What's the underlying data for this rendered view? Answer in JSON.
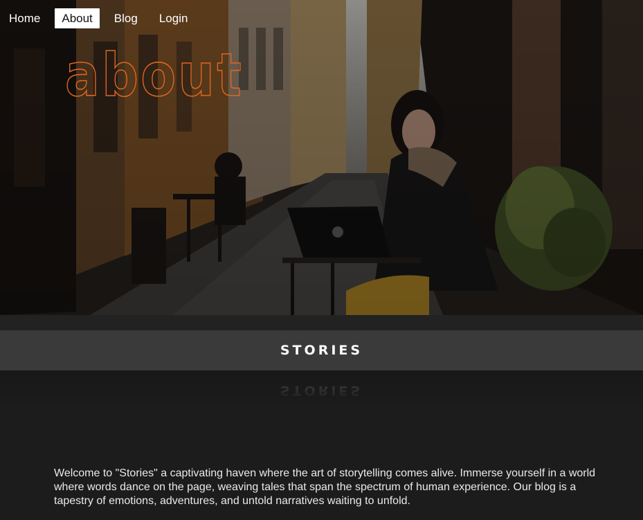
{
  "nav": {
    "items": [
      {
        "label": "Home",
        "active": false
      },
      {
        "label": "About",
        "active": true
      },
      {
        "label": "Blog",
        "active": false
      },
      {
        "label": "Login",
        "active": false
      }
    ]
  },
  "hero": {
    "title": "about",
    "title_color": "#e0661f",
    "image": "woman-with-laptop-cafe-street"
  },
  "section": {
    "heading": "STORIES",
    "reflection": "STORIES"
  },
  "intro": {
    "text": "Welcome to \"Stories\" a captivating haven where the art of storytelling comes alive. Immerse yourself in a world where words dance on the page, weaving tales that span the spectrum of human experience. Our blog is a tapestry of emotions, adventures, and untold narratives waiting to unfold."
  }
}
